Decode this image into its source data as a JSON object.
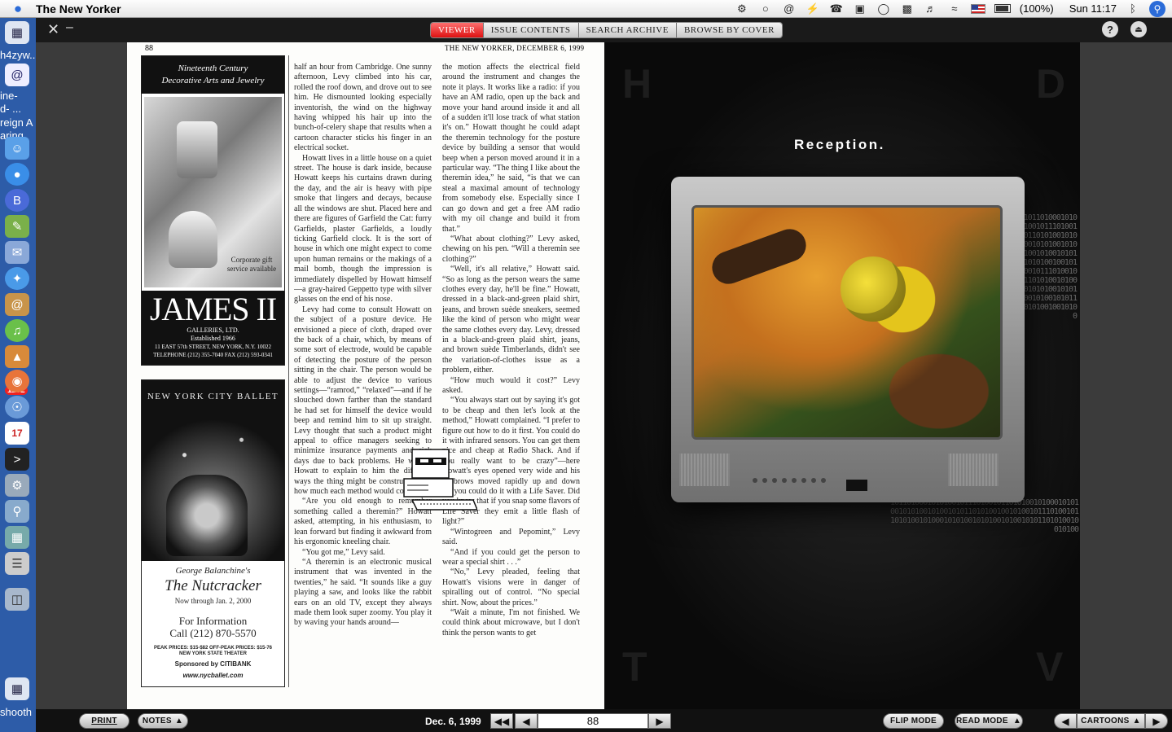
{
  "menubar": {
    "app_name": "The New Yorker",
    "battery": "(100%)",
    "clock": "Sun 11:17"
  },
  "dock": {
    "labels": [
      "h4zyw...",
      "ine-",
      "d- ...",
      "reign A",
      "aring",
      "shooth"
    ],
    "badge": "1102"
  },
  "viewer": {
    "tabs": [
      "VIEWER",
      "ISSUE CONTENTS",
      "SEARCH ARCHIVE",
      "BROWSE BY COVER"
    ],
    "active_tab": "VIEWER",
    "help_label": "?"
  },
  "page_left": {
    "page_number": "88",
    "running_head": "THE NEW YORKER, DECEMBER 6, 1999",
    "ad1": {
      "heading_line1": "Nineteenth Century",
      "heading_line2": "Decorative Arts and Jewelry",
      "gift": "Corporate gift service available",
      "brand": "JAMES II",
      "sub1": "GALLERIES, LTD.",
      "sub2": "Established 1966",
      "address": "11 EAST 57th STREET, NEW YORK, N.Y. 10022",
      "phone": "TELEPHONE (212) 355-7040   FAX (212) 593-0341"
    },
    "ad2": {
      "heading": "NEW YORK CITY BALLET",
      "author": "George Balanchine's",
      "title": "The Nutcracker",
      "dates": "Now through Jan. 2, 2000",
      "info1": "For Information",
      "info2": "Call (212) 870-5570",
      "prices": "PEAK PRICES: $15-$82   OFF-PEAK PRICES: $15-76",
      "theater": "NEW YORK STATE THEATER",
      "sponsor": "Sponsored by CITIBANK",
      "url": "www.nycballet.com"
    },
    "col1": [
      "half an hour from Cambridge. One sunny afternoon, Levy climbed into his car, rolled the roof down, and drove out to see him. He dismounted looking especially inventorish, the wind on the highway having whipped his hair up into the bunch-of-celery shape that results when a cartoon character sticks his finger in an electrical socket.",
      "Howatt lives in a little house on a quiet street. The house is dark inside, because Howatt keeps his curtains drawn during the day, and the air is heavy with pipe smoke that lingers and decays, because all the windows are shut. Placed here and there are figures of Garfield the Cat: furry Garfields, plaster Garfields, a loudly ticking Garfield clock. It is the sort of house in which one might expect to come upon human remains or the makings of a mail bomb, though the impression is immediately dispelled by Howatt himself—a gray-haired Geppetto type with silver glasses on the end of his nose.",
      "Levy had come to consult Howatt on the subject of a posture device. He envisioned a piece of cloth, draped over the back of a chair, which, by means of some sort of electrode, would be capable of detecting the posture of the person sitting in the chair. The person would be able to adjust the device to various settings—“ramrod,” “relaxed”—and if he slouched down farther than the standard he had set for himself the device would beep and remind him to sit up straight. Levy thought that such a product might appeal to office managers seeking to minimize insurance payments and sick days due to back problems. He wanted Howatt to explain to him the different ways the thing might be constructed and how much each method would cost.",
      "“Are you old enough to remember something called a theremin?” Howatt asked, attempting, in his enthusiasm, to lean forward but finding it awkward from his ergonomic kneeling chair.",
      "“You got me,” Levy said.",
      "“A theremin is an electronic musical instrument that was invented in the twenties,” he said. “It sounds like a guy playing a saw, and looks like the rabbit ears on an old TV, except they always made them look super zoomy. You play it by waving your hands around—"
    ],
    "col2": [
      "the motion affects the electrical field around the instrument and changes the note it plays. It works like a radio: if you have an AM radio, open up the back and move your hand around inside it and all of a sudden it'll lose track of what station it's on.” Howatt thought he could adapt the theremin technology for the posture device by building a sensor that would beep when a person moved around it in a particular way. “The thing I like about the theremin idea,” he said, “is that we can steal a maximal amount of technology from somebody else. Especially since I can go down and get a free AM radio with my oil change and build it from that.”",
      "“What about clothing?” Levy asked, chewing on his pen. “Will a theremin see clothing?”",
      "“Well, it's all relative,” Howatt said. “So as long as the person wears the same clothes every day, he'll be fine.” Howatt, dressed in a black-and-green plaid shirt, jeans, and brown suède sneakers, seemed like the kind of person who might wear the same clothes every day. Levy, dressed in a black-and-green plaid shirt, jeans, and brown suède Timberlands, didn't see the variation-of-clothes issue as a problem, either.",
      "“How much would it cost?” Levy asked.",
      "“You always start out by saying it's got to be cheap and then let's look at the method,” Howatt complained. “I prefer to figure out how to do it first. You could do it with infrared sensors. You can get them nice and cheap at Radio Shack. And if you really want to be crazy”—here Howatt's eyes opened very wide and his eyebrows moved rapidly up and down—“you could do it with a Life Saver. Did you know that if you snap some flavors of Life Saver they emit a little flash of light?”",
      "“Wintogreen and Pepomint,” Levy said.",
      "“And if you could get the person to wear a special shirt . . .”",
      "“No,” Levy pleaded, feeling that Howatt's visions were in danger of spiralling out of control. “No special shirt. Now, about the prices.”",
      "“Wait a minute, I'm not finished. We could think about microwave, but I don't think the person wants to get"
    ]
  },
  "page_right": {
    "headline": "Reception.",
    "ghost_letters": [
      "H",
      "D",
      "T",
      "V"
    ],
    "binary": "101101000101010010111010010110101001010001010100101010010100101011010100100101001011101001011010100101000101010010101001010010101101010010010100"
  },
  "bottombar": {
    "print": "PRINT",
    "notes": "NOTES",
    "date": "Dec. 6, 1999",
    "page": "88",
    "flip_mode": "FLIP MODE",
    "read_mode": "READ MODE",
    "cartoons": "CARTOONS"
  }
}
